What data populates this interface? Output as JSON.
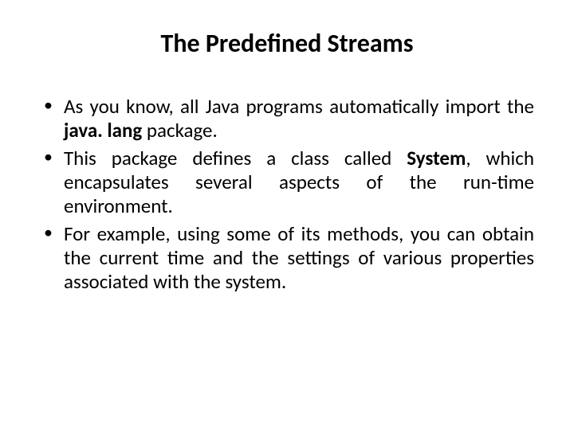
{
  "title": "The Predefined Streams",
  "bullets": [
    {
      "prefix": "As you know, all Java programs automatically import the ",
      "bold1": "java. lang ",
      "suffix": "package."
    },
    {
      "prefix": "This package defines a class called ",
      "bold1": "System",
      "suffix": ", which encapsulates several aspects of the run-time environment."
    },
    {
      "prefix": "For example, using some of its methods, you can obtain the current time and the settings of various properties associated with the system.",
      "bold1": "",
      "suffix": ""
    }
  ]
}
